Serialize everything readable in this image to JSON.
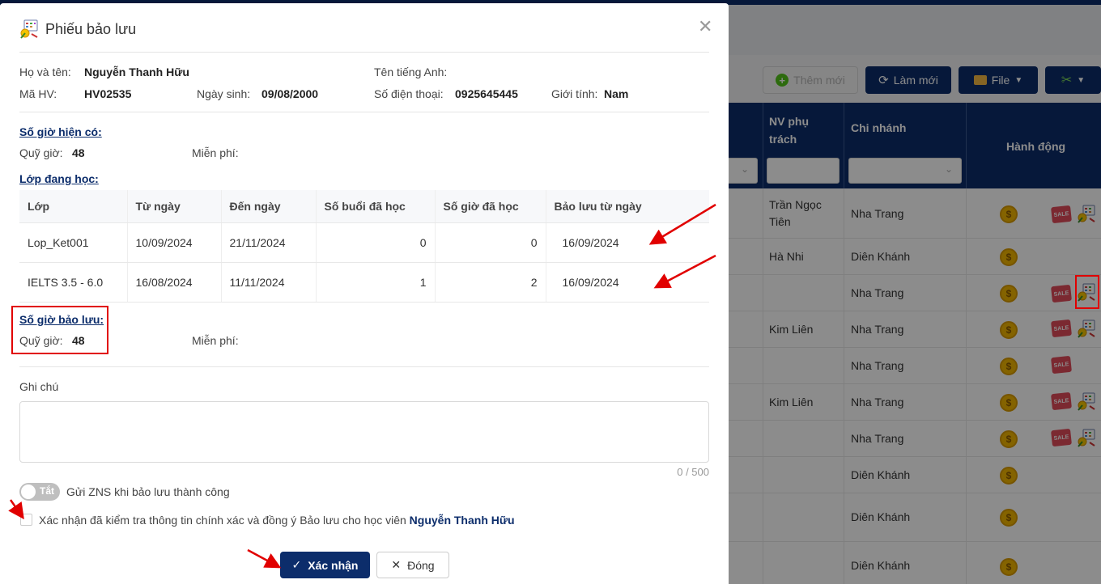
{
  "toolbar": {
    "add_label": "Thêm mới",
    "refresh_label": "Làm mới",
    "file_label": "File"
  },
  "grid": {
    "headers": {
      "staff": "NV phụ trách",
      "staff_line1": "NV phụ",
      "staff_line2": "trách",
      "branch": "Chi nhánh",
      "actions": "Hành động"
    },
    "rows": [
      {
        "staff_line1": "Trần Ngọc",
        "staff_line2": "Tiên",
        "branch": "Nha Trang"
      },
      {
        "staff_line1": "Hà Nhi",
        "staff_line2": "",
        "branch": "Diên Khánh"
      },
      {
        "staff_line1": "",
        "staff_line2": "",
        "branch": "Nha Trang"
      },
      {
        "staff_line1": "Kim Liên",
        "staff_line2": "",
        "branch": "Nha Trang"
      },
      {
        "staff_line1": "",
        "staff_line2": "",
        "branch": "Nha Trang"
      },
      {
        "staff_line1": "Kim Liên",
        "staff_line2": "",
        "branch": "Nha Trang"
      },
      {
        "staff_line1": "",
        "staff_line2": "",
        "branch": "Nha Trang"
      },
      {
        "staff_line1": "",
        "staff_line2": "",
        "branch": "Diên Khánh"
      },
      {
        "staff_line1": "",
        "staff_line2": "",
        "branch": "Diên Khánh"
      },
      {
        "staff_line1": "",
        "staff_line2": "",
        "branch": "Diên Khánh"
      }
    ],
    "sale_badge_text": "SALE"
  },
  "modal": {
    "title": "Phiếu bảo lưu",
    "student": {
      "name_label": "Họ và tên:",
      "name": "Nguyễn Thanh Hữu",
      "english_name_label": "Tên tiếng Anh:",
      "english_name": "",
      "code_label": "Mã HV:",
      "code": "HV02535",
      "dob_label": "Ngày sinh:",
      "dob": "09/08/2000",
      "phone_label": "Số điện thoại:",
      "phone": "0925645445",
      "gender_label": "Giới tính:",
      "gender": "Nam"
    },
    "current_hours": {
      "heading": "Số giờ hiện có:",
      "quota_label": "Quỹ giờ:",
      "quota": "48",
      "free_label": "Miễn phí:",
      "free": ""
    },
    "classes": {
      "heading": "Lớp đang học:",
      "columns": [
        "Lớp",
        "Từ ngày",
        "Đến ngày",
        "Số buổi đã học",
        "Số giờ đã học",
        "Bảo lưu từ ngày"
      ],
      "rows": [
        [
          "Lop_Ket001",
          "10/09/2024",
          "21/11/2024",
          "0",
          "0",
          "16/09/2024"
        ],
        [
          "IELTS 3.5 - 6.0",
          "16/08/2024",
          "11/11/2024",
          "1",
          "2",
          "16/09/2024"
        ]
      ]
    },
    "reserve_hours": {
      "heading": "Số giờ bảo lưu:",
      "quota_label": "Quỹ giờ:",
      "quota": "48",
      "free_label": "Miễn phí:",
      "free": ""
    },
    "note": {
      "label": "Ghi chú",
      "value": "",
      "counter": "0 / 500"
    },
    "zns": {
      "toggle_text": "Tắt",
      "label": "Gửi ZNS khi bảo lưu thành công"
    },
    "confirm": {
      "text": "Xác nhận đã kiểm tra thông tin chính xác và đồng ý Bảo lưu cho học viên",
      "student_name": "Nguyễn Thanh Hữu"
    },
    "buttons": {
      "confirm": "Xác nhận",
      "close": "Đóng"
    }
  },
  "colors": {
    "brand_navy": "#0c2d6b",
    "annotation_red": "#e10000",
    "coin_gold": "#f0b400"
  }
}
